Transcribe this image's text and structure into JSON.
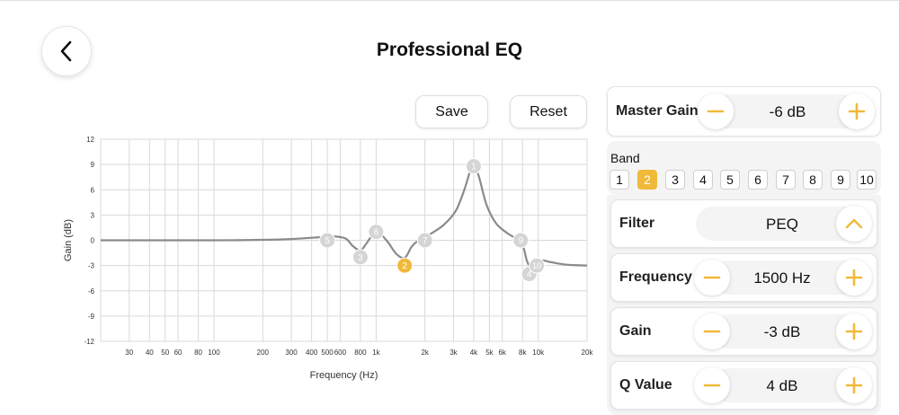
{
  "header": {
    "title": "Professional EQ"
  },
  "toolbar": {
    "save_label": "Save",
    "reset_label": "Reset"
  },
  "icons": {
    "back": "chevron-left-icon",
    "minus": "minus-icon",
    "plus": "plus-icon",
    "collapse": "chevron-up-icon"
  },
  "colors": {
    "accent": "#f0b93a",
    "curve": "#8a8a8a",
    "grid": "#d9d9d9"
  },
  "master_gain": {
    "label": "Master Gain",
    "value": "-6 dB"
  },
  "band_selector": {
    "label": "Band",
    "bands": [
      "1",
      "2",
      "3",
      "4",
      "5",
      "6",
      "7",
      "8",
      "9",
      "10"
    ],
    "selected": "2"
  },
  "filter": {
    "label": "Filter",
    "value": "PEQ"
  },
  "frequency": {
    "label": "Frequency",
    "value": "1500 Hz"
  },
  "gain": {
    "label": "Gain",
    "value": "-3 dB"
  },
  "q_value": {
    "label": "Q Value",
    "value": "4 dB"
  },
  "chart_data": {
    "type": "line",
    "title": "",
    "xlabel": "Frequency (Hz)",
    "ylabel": "Gain (dB)",
    "x_scale": "log",
    "xlim": [
      20,
      20000
    ],
    "ylim": [
      -12,
      12
    ],
    "x_ticks": [
      30,
      40,
      50,
      60,
      80,
      100,
      200,
      300,
      400,
      500,
      600,
      800,
      1000,
      2000,
      3000,
      4000,
      5000,
      6000,
      8000,
      10000,
      20000
    ],
    "x_tick_labels": [
      "30",
      "40",
      "50",
      "60",
      "80",
      "100",
      "200",
      "300",
      "400",
      "500",
      "600",
      "800",
      "1k",
      "2k",
      "3k",
      "4k",
      "5k",
      "6k",
      "8k",
      "10k",
      "20k"
    ],
    "y_ticks": [
      -12,
      -9,
      -6,
      -3,
      0,
      3,
      6,
      9,
      12
    ],
    "grid": true,
    "curve": [
      [
        20,
        0
      ],
      [
        100,
        0
      ],
      [
        200,
        0.05
      ],
      [
        300,
        0.15
      ],
      [
        400,
        0.3
      ],
      [
        480,
        0.4
      ],
      [
        560,
        0.45
      ],
      [
        650,
        0.2
      ],
      [
        720,
        -0.7
      ],
      [
        800,
        -1.2
      ],
      [
        870,
        -0.4
      ],
      [
        950,
        0.6
      ],
      [
        1050,
        0.8
      ],
      [
        1180,
        -0.2
      ],
      [
        1330,
        -1.6
      ],
      [
        1500,
        -2.1
      ],
      [
        1650,
        -0.8
      ],
      [
        1800,
        -0.1
      ],
      [
        2100,
        0.6
      ],
      [
        2600,
        1.8
      ],
      [
        3100,
        3.5
      ],
      [
        3500,
        6.0
      ],
      [
        3800,
        8.2
      ],
      [
        4000,
        8.8
      ],
      [
        4300,
        7.6
      ],
      [
        4800,
        4.2
      ],
      [
        5500,
        2.0
      ],
      [
        6500,
        0.8
      ],
      [
        7500,
        0.1
      ],
      [
        8000,
        -0.4
      ],
      [
        8500,
        -2.4
      ],
      [
        9000,
        -3.2
      ],
      [
        9500,
        -3.0
      ],
      [
        10500,
        -2.4
      ],
      [
        12000,
        -2.6
      ],
      [
        15000,
        -2.9
      ],
      [
        20000,
        -3.0
      ]
    ],
    "bands": [
      {
        "label": "1",
        "freq": 4000,
        "gain": 8.8,
        "selected": false
      },
      {
        "label": "2",
        "freq": 1500,
        "gain": -3.0,
        "selected": true
      },
      {
        "label": "3",
        "freq": 800,
        "gain": -2.0,
        "selected": false
      },
      {
        "label": "4",
        "freq": 8800,
        "gain": -4.0,
        "selected": false
      },
      {
        "label": "5",
        "freq": 500,
        "gain": 0.0,
        "selected": false
      },
      {
        "label": "6",
        "freq": 1000,
        "gain": 1.0,
        "selected": false
      },
      {
        "label": "7",
        "freq": 2000,
        "gain": 0.0,
        "selected": false
      },
      {
        "label": "9",
        "freq": 7800,
        "gain": 0.0,
        "selected": false
      },
      {
        "label": "10",
        "freq": 9800,
        "gain": -3.0,
        "selected": false
      }
    ]
  }
}
